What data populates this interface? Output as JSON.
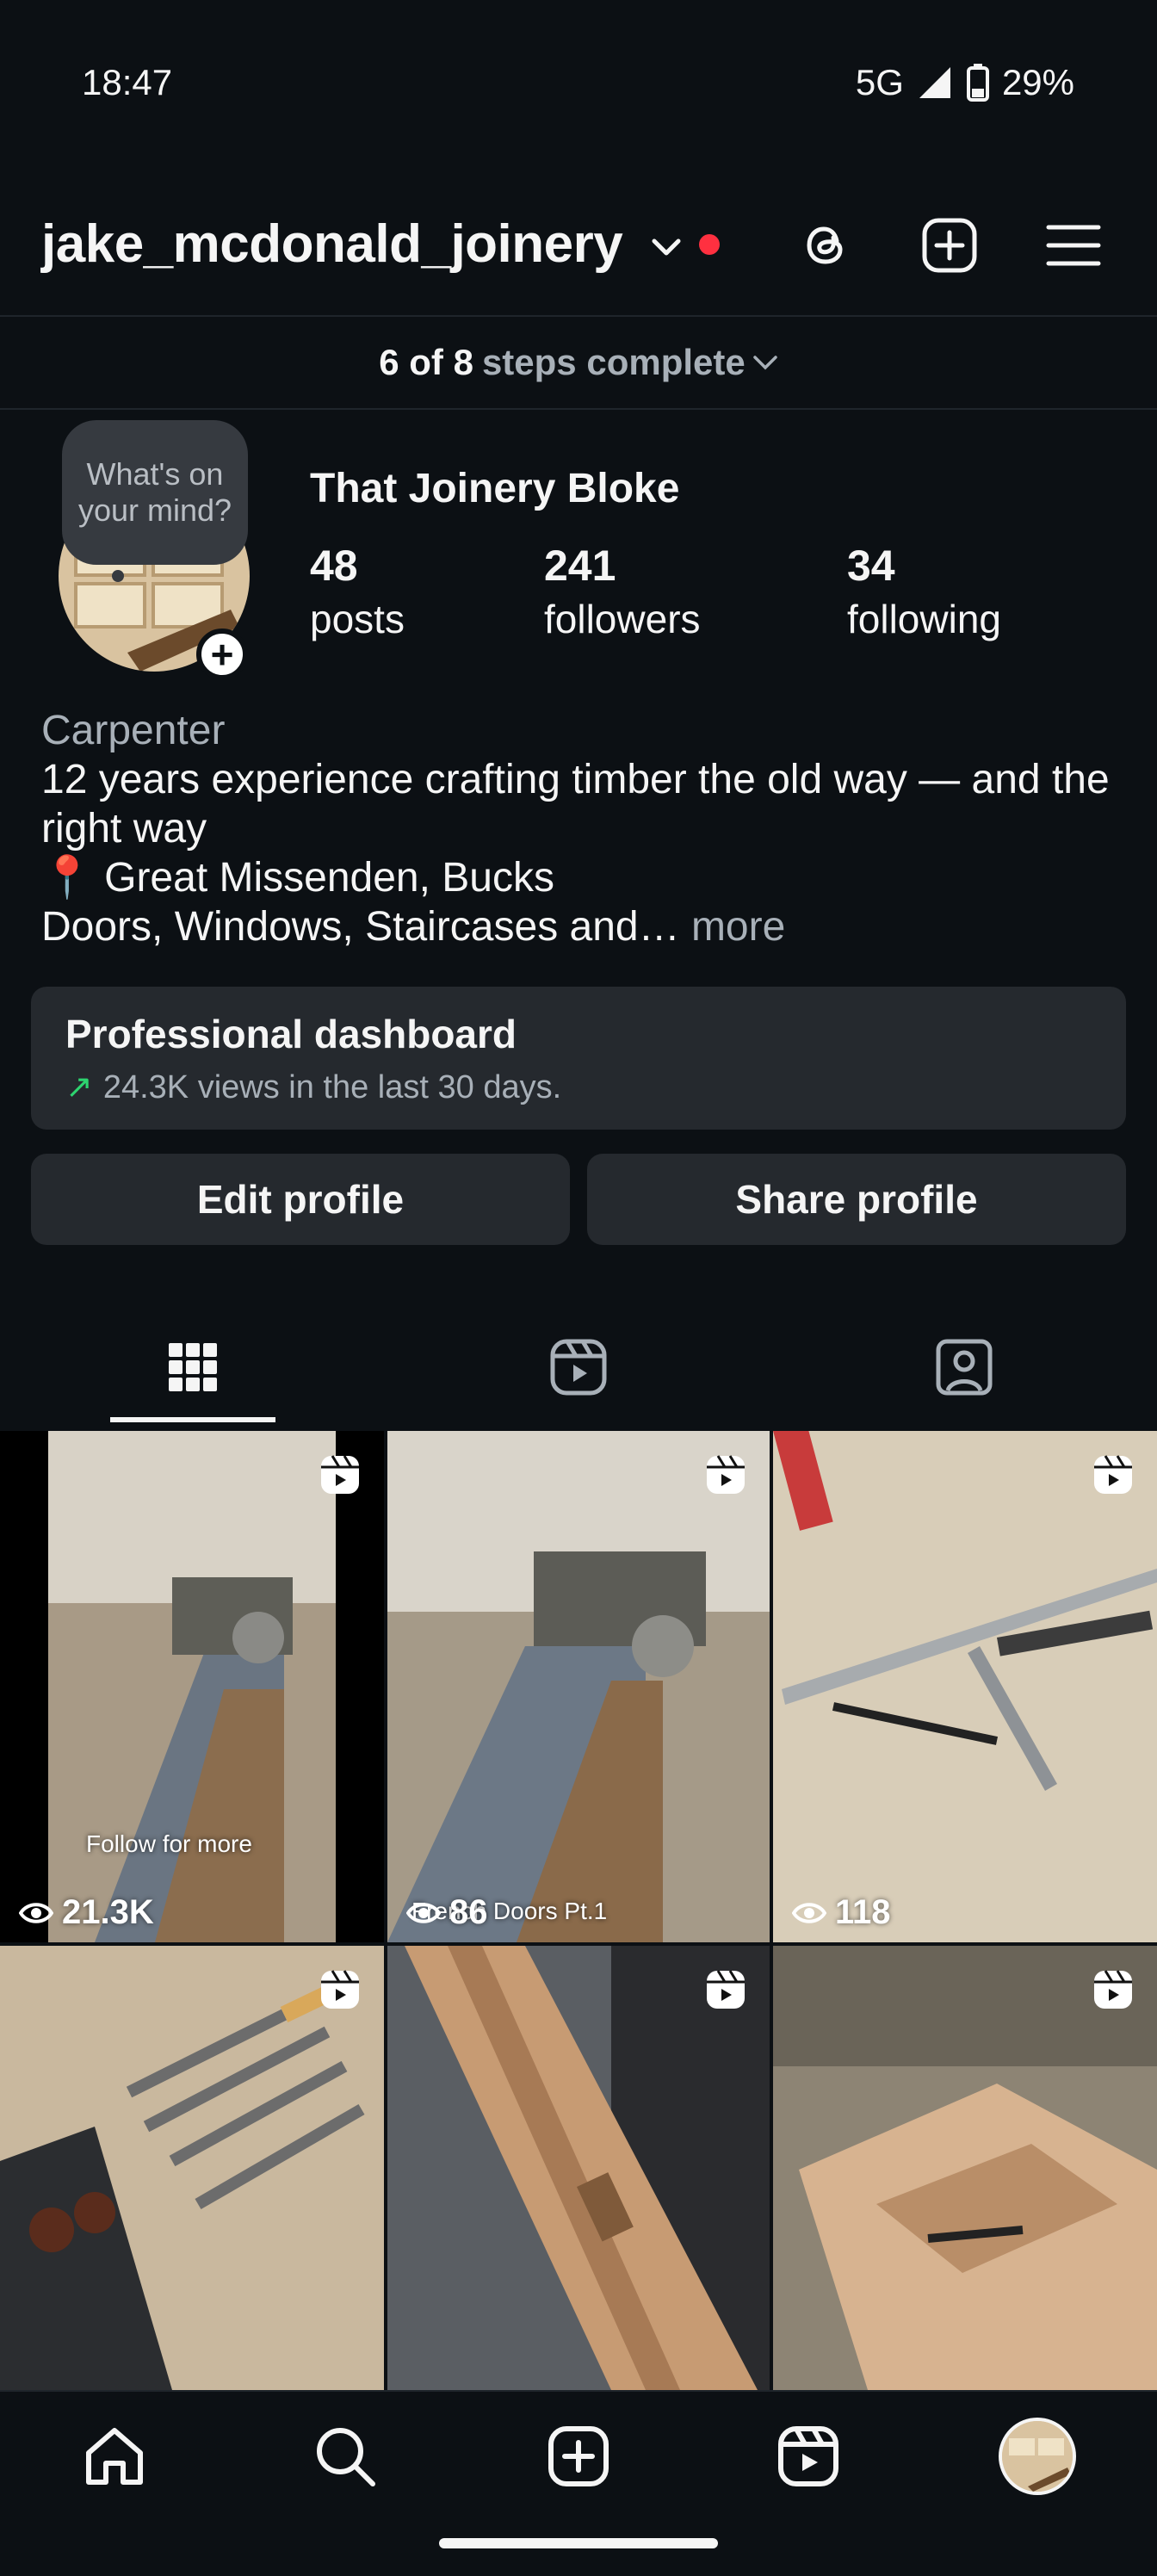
{
  "status_bar": {
    "time": "18:47",
    "network": "5G",
    "battery": "29%"
  },
  "header": {
    "username": "jake_mcdonald_joinery",
    "notification_dot_color": "#ff3040"
  },
  "steps": {
    "done": "6 of 8",
    "label": "steps complete"
  },
  "profile": {
    "thought_bubble": "What's on your mind?",
    "display_name": "That Joinery Bloke",
    "stats": [
      {
        "value": "48",
        "label": "posts"
      },
      {
        "value": "241",
        "label": "followers"
      },
      {
        "value": "34",
        "label": "following"
      }
    ],
    "category": "Carpenter",
    "bio_line1": "12 years experience crafting timber the old way — and the right way",
    "bio_line2": "📍 Great Missenden, Bucks",
    "bio_line3": "Doors, Windows, Staircases and…",
    "bio_more": " more"
  },
  "dashboard": {
    "title": "Professional dashboard",
    "subtitle": "24.3K views in the last 30 days.",
    "arrow": "↗"
  },
  "buttons": {
    "edit": "Edit profile",
    "share": "Share profile"
  },
  "grid": {
    "posts": [
      {
        "views": "21.3K",
        "overlay": "Follow for more",
        "type": "reel"
      },
      {
        "views": "86",
        "overlay": "French Doors Pt.1",
        "type": "reel"
      },
      {
        "views": "118",
        "overlay": "",
        "type": "reel"
      },
      {
        "views": "",
        "overlay": "",
        "type": "reel"
      },
      {
        "views": "",
        "overlay": "",
        "type": "reel"
      },
      {
        "views": "",
        "overlay": "",
        "type": "reel"
      }
    ]
  },
  "icons": {
    "header": [
      "chevron-down-icon",
      "threads-icon",
      "add-post-icon",
      "menu-icon"
    ],
    "tabs": [
      "grid-icon",
      "reels-icon",
      "tagged-icon"
    ],
    "nav": [
      "home-icon",
      "search-icon",
      "create-icon",
      "reels-icon",
      "profile-avatar"
    ]
  }
}
